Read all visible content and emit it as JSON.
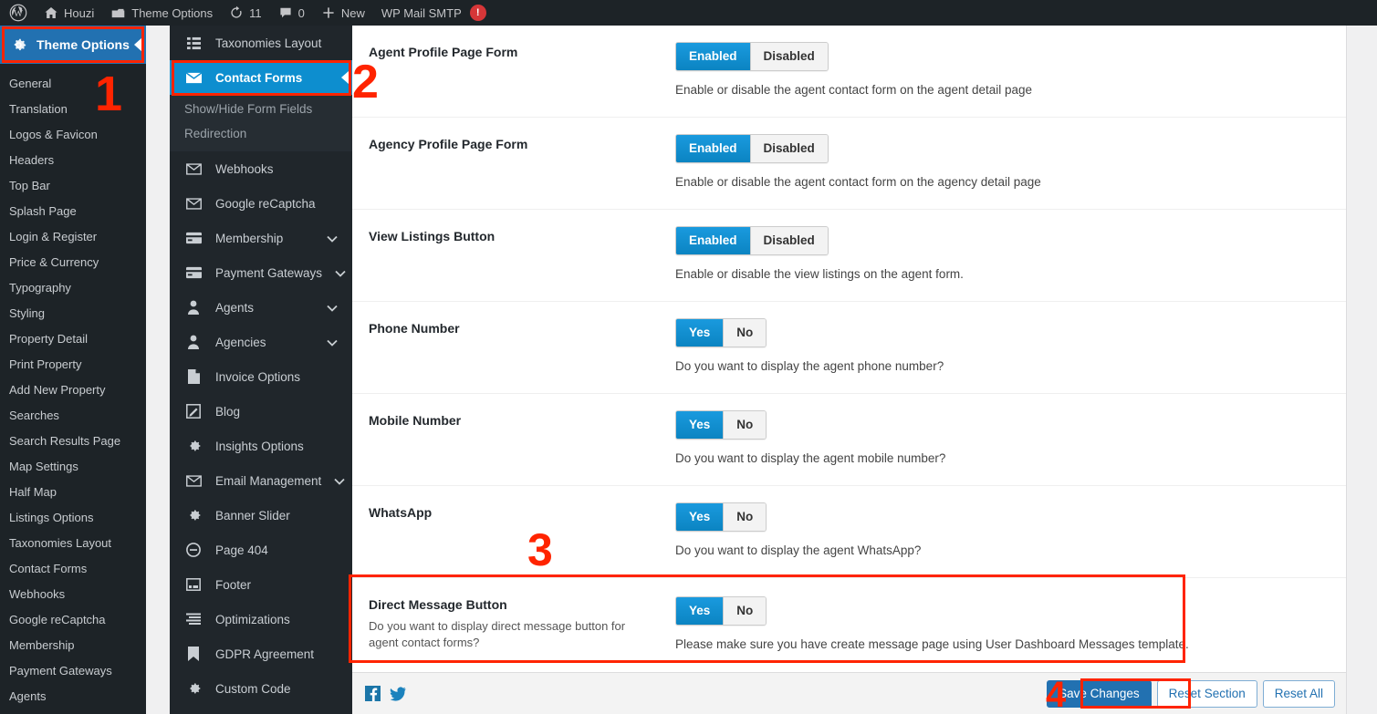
{
  "adminbar": {
    "items": [
      {
        "icon": "wordpress-logo-icon",
        "label": ""
      },
      {
        "icon": "home-icon",
        "label": "Houzi"
      },
      {
        "icon": "briefcase-icon",
        "label": "Theme Options"
      },
      {
        "icon": "update-icon",
        "label": "11"
      },
      {
        "icon": "comment-icon",
        "label": "0"
      },
      {
        "icon": "plus-icon",
        "label": "New"
      },
      {
        "icon": "mail-smtp-icon",
        "label": "WP Mail SMTP",
        "badge": "!"
      }
    ]
  },
  "wp_sidebar": {
    "active_label": "Theme Options",
    "active_icon": "gear-icon",
    "items": [
      {
        "label": "General"
      },
      {
        "label": "Translation"
      },
      {
        "label": "Logos & Favicon"
      },
      {
        "label": "Headers"
      },
      {
        "label": "Top Bar"
      },
      {
        "label": "Splash Page"
      },
      {
        "label": "Login & Register"
      },
      {
        "label": "Price & Currency"
      },
      {
        "label": "Typography"
      },
      {
        "label": "Styling"
      },
      {
        "label": "Property Detail"
      },
      {
        "label": "Print Property"
      },
      {
        "label": "Add New Property"
      },
      {
        "label": "Searches"
      },
      {
        "label": "Search Results Page"
      },
      {
        "label": "Map Settings"
      },
      {
        "label": "Half Map"
      },
      {
        "label": "Listings Options"
      },
      {
        "label": "Taxonomies Layout"
      },
      {
        "label": "Contact Forms"
      },
      {
        "label": "Webhooks"
      },
      {
        "label": "Google reCaptcha"
      },
      {
        "label": "Membership"
      },
      {
        "label": "Payment Gateways"
      },
      {
        "label": "Agents"
      }
    ]
  },
  "options_panel": {
    "items": [
      {
        "label": "Taxonomies Layout",
        "icon": "list-icon",
        "active": false,
        "chevron": false
      },
      {
        "label": "Contact Forms",
        "icon": "envelope-icon",
        "active": true,
        "chevron": false
      },
      {
        "label": "Webhooks",
        "icon": "envelope-icon",
        "active": false,
        "chevron": false
      },
      {
        "label": "Google reCaptcha",
        "icon": "envelope-icon",
        "active": false,
        "chevron": false
      },
      {
        "label": "Membership",
        "icon": "card-icon",
        "active": false,
        "chevron": true
      },
      {
        "label": "Payment Gateways",
        "icon": "card-icon",
        "active": false,
        "chevron": true
      },
      {
        "label": "Agents",
        "icon": "user-icon",
        "active": false,
        "chevron": true
      },
      {
        "label": "Agencies",
        "icon": "user-icon",
        "active": false,
        "chevron": true
      },
      {
        "label": "Invoice Options",
        "icon": "document-icon",
        "active": false,
        "chevron": false
      },
      {
        "label": "Blog",
        "icon": "pencil-square-icon",
        "active": false,
        "chevron": false
      },
      {
        "label": "Insights Options",
        "icon": "gear-icon",
        "active": false,
        "chevron": false
      },
      {
        "label": "Email Management",
        "icon": "envelope-icon",
        "active": false,
        "chevron": true
      },
      {
        "label": "Banner Slider",
        "icon": "gear-icon",
        "active": false,
        "chevron": false
      },
      {
        "label": "Page 404",
        "icon": "minus-circle-icon",
        "active": false,
        "chevron": false
      },
      {
        "label": "Footer",
        "icon": "window-icon",
        "active": false,
        "chevron": false
      },
      {
        "label": "Optimizations",
        "icon": "sliders-icon",
        "active": false,
        "chevron": false
      },
      {
        "label": "GDPR Agreement",
        "icon": "bookmark-icon",
        "active": false,
        "chevron": false
      },
      {
        "label": "Custom Code",
        "icon": "gear-icon",
        "active": false,
        "chevron": false
      }
    ],
    "subitems": [
      {
        "label": "Show/Hide Form Fields"
      },
      {
        "label": "Redirection"
      }
    ]
  },
  "main": {
    "rows": [
      {
        "title": "Agent Profile Page Form",
        "on_label": "Enabled",
        "off_label": "Disabled",
        "selected": "Enabled",
        "help": "Enable or disable the agent contact form on the agent detail page"
      },
      {
        "title": "Agency Profile Page Form",
        "on_label": "Enabled",
        "off_label": "Disabled",
        "selected": "Enabled",
        "help": "Enable or disable the agent contact form on the agency detail page"
      },
      {
        "title": "View Listings Button",
        "on_label": "Enabled",
        "off_label": "Disabled",
        "selected": "Enabled",
        "help": "Enable or disable the view listings on the agent form."
      },
      {
        "title": "Phone Number",
        "on_label": "Yes",
        "off_label": "No",
        "selected": "Yes",
        "help": "Do you want to display the agent phone number?"
      },
      {
        "title": "Mobile Number",
        "on_label": "Yes",
        "off_label": "No",
        "selected": "Yes",
        "help": "Do you want to display the agent mobile number?"
      },
      {
        "title": "WhatsApp",
        "on_label": "Yes",
        "off_label": "No",
        "selected": "Yes",
        "help": "Do you want to display the agent WhatsApp?"
      }
    ],
    "direct_message_row": {
      "title": "Direct Message Button",
      "description": "Do you want to display direct message button for agent contact forms?",
      "on_label": "Yes",
      "off_label": "No",
      "selected": "Yes",
      "help": "Please make sure you have create message page using User Dashboard Messages template."
    }
  },
  "footer": {
    "social": [
      {
        "name": "facebook-icon"
      },
      {
        "name": "twitter-icon"
      }
    ],
    "save_label": "Save Changes",
    "reset_section_label": "Reset Section",
    "reset_all_label": "Reset All"
  },
  "annotations": {
    "one": "1",
    "two": "2",
    "three": "3",
    "four": "4"
  },
  "colors": {
    "accent_blue": "#0d8ecf",
    "wp_blue": "#2271b1",
    "annotation_red": "#ff2400",
    "sidebar_dark": "#1d2327",
    "panel_dark": "#20262b"
  }
}
